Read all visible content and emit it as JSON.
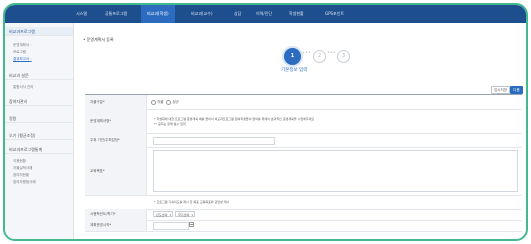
{
  "nav": {
    "items": [
      "시스템",
      "공통프로그램",
      "비교과(학생)",
      "비교과(교수)",
      "상담",
      "이력/진단",
      "학생현황",
      "GPS포인트"
    ],
    "active_index": 2
  },
  "sidebar": {
    "head1": "비교과프로그램",
    "group1": [
      {
        "label": "운영계획서",
        "active": false
      },
      {
        "label": "프로그램",
        "active": false
      },
      {
        "label": "결과보고서",
        "active": true
      }
    ],
    "head2": "비교과 설문",
    "sub2": "통합서식 관리",
    "head3": "참여자관리",
    "head4": "정원",
    "head5": "오기 (평균조정)",
    "head6": "비교과프로그램통계",
    "group6": [
      "이용현황",
      "자율실적사례",
      "참여자현황",
      "참여자평점사례"
    ]
  },
  "page": {
    "title": "• 운영계획서 등록",
    "steps": [
      "1",
      "2",
      "3"
    ],
    "step_caption": "기본정보 입력",
    "temp_save": "임시저장",
    "next": "다음"
  },
  "form": {
    "row1_label": "자율구분*",
    "radio1": "자율",
    "radio2": "정규",
    "row2_label": "운영계획서명*",
    "row2_note1": "* 학생회에 대한 프로그램 운영계획 예를 들어서 비교과프로그램 참여학생들의 편의를 위해서 효과적인 운영계획을 수립해주세요",
    "row2_note2": "** 공지는 정해 필수 입력",
    "row3_label": "주최 기관/주최담당*",
    "row4_label": "교육목표*",
    "row5_note": "* 프로그램 기획의도를 제시 한 목표 교육목표와 관련성 제시",
    "row6_label": "시행학년도/학기*",
    "select1": "년도선택",
    "select2": "학기선택",
    "row7_label": "계획운영시작*"
  },
  "colors": {
    "frame": "#43b98e",
    "nav_bg": "#1d4f8f",
    "accent": "#2b6cc0"
  }
}
